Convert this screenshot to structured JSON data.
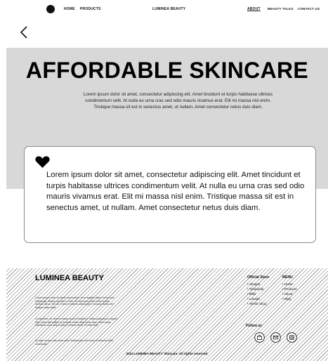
{
  "nav": {
    "home": "HOME",
    "products": "PRODUCTS",
    "brand": "LUMINEA BEAUTY",
    "about": "ABOUT",
    "beauty_talks": "BEAUTY TALKS",
    "contact": "CONTACT US"
  },
  "hero": {
    "title": "AFFORDABLE SKINCARE",
    "text": "Lorem ipsum dolor sit amet, consectetur adipiscing elit. Amet tincidunt et turpis habitasse ultrices condimentum velit. At nulla eu urna cras sed odio mauris vivamus erat. Elit mi massa nisl enim. Tristique massa sit est in senectus amet, ut nullam. Amet consectetur netus duis diam."
  },
  "card": {
    "text": "Lorem ipsum dolor sit amet, consectetur adipiscing elit. Amet tincidunt et turpis habitasse ultrices condimentum velit. At nulla eu urna cras sed odio mauris vivamus erat. Elit mi massa nisl enim. Tristique massa sit est in senectus amet, ut nullam. Amet consectetur netus duis diam."
  },
  "footer": {
    "brand": "LUMINEA BEAUTY",
    "para1": "Lorem ipsum dolor sit amet consectetur. Urna sagittis aliquet tellus sed adipiscing. Mauris dui odio in nibh. At nulla proin tortor felis montes aenean lacus. Elit vel. Tortor in mauris ullamcorper rhoncus mattis sed tempus diam dolor.",
    "para2": "Consectetur sit viverra massa urna id fringilla in. Malesuada purus aliquet felis. Imperdiet mattis et pulvinar mollis risus netus duis. Amet turpis habitasse nunc aliquet ipsum pretium amet. Id vitae felis.",
    "para3": "Ac eget ornare odio amet enim ullamcorper sed nunc at euismod nibh consequat.",
    "col1_title": "Official Store",
    "col1_items": [
      "Shopee",
      "Tokopedia",
      "Blibli",
      "Lazada",
      "TikTok Shop"
    ],
    "col2_title": "MENU",
    "col2_items": [
      "Home",
      "Products",
      "About",
      "Blog"
    ],
    "follow": "Follow us",
    "copyright": "2024 LUMINEA BEAUTY Skincare. All rights reserved."
  }
}
